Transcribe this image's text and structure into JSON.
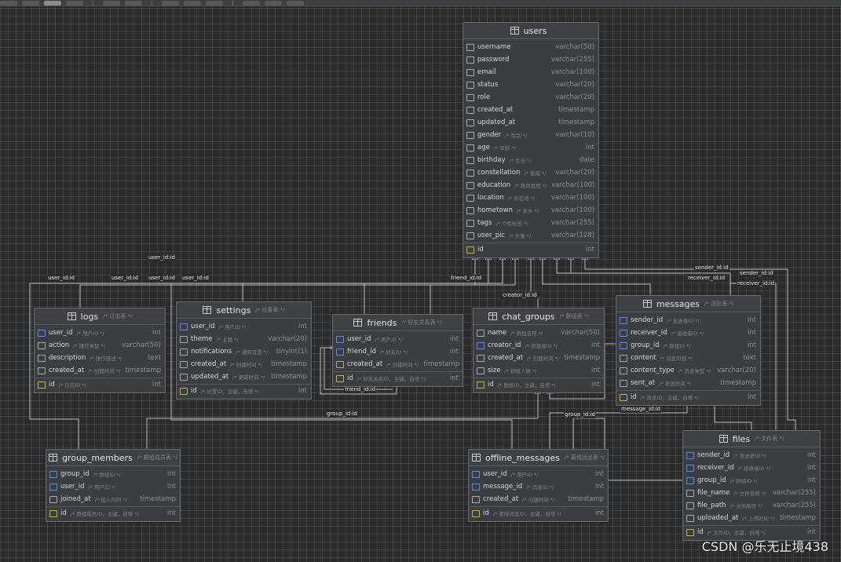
{
  "watermark": "CSDN @乐无止境438",
  "entities": {
    "users": {
      "name": "users",
      "comment": "",
      "columns": [
        {
          "name": "username",
          "comment": "",
          "type": "varchar(50)"
        },
        {
          "name": "password",
          "comment": "",
          "type": "varchar(255)"
        },
        {
          "name": "email",
          "comment": "",
          "type": "varchar(100)"
        },
        {
          "name": "status",
          "comment": "",
          "type": "varchar(20)"
        },
        {
          "name": "role",
          "comment": "",
          "type": "varchar(20)"
        },
        {
          "name": "created_at",
          "comment": "",
          "type": "timestamp"
        },
        {
          "name": "updated_at",
          "comment": "",
          "type": "timestamp"
        },
        {
          "name": "gender",
          "comment": "/* 性别 */",
          "type": "varchar(10)"
        },
        {
          "name": "age",
          "comment": "/* 年龄 */",
          "type": "int"
        },
        {
          "name": "birthday",
          "comment": "/* 生日 */",
          "type": "date"
        },
        {
          "name": "constellation",
          "comment": "/* 星座 */",
          "type": "varchar(20)"
        },
        {
          "name": "education",
          "comment": "/* 教育程度 */",
          "type": "varchar(100)"
        },
        {
          "name": "location",
          "comment": "/* 所在地 */",
          "type": "varchar(100)"
        },
        {
          "name": "hometown",
          "comment": "/* 家乡 */",
          "type": "varchar(100)"
        },
        {
          "name": "tags",
          "comment": "/* 个性标签 */",
          "type": "varchar(255)"
        },
        {
          "name": "user_pic",
          "comment": "/* 头像 */",
          "type": "varchar(128)"
        }
      ],
      "pk": {
        "name": "id",
        "comment": "",
        "type": "int"
      }
    },
    "logs": {
      "name": "logs",
      "comment": "/* 日志表 */",
      "columns": [
        {
          "name": "user_id",
          "comment": "/* 用户ID */",
          "type": "int"
        },
        {
          "name": "action",
          "comment": "/* 操作类型 */",
          "type": "varchar(50)"
        },
        {
          "name": "description",
          "comment": "/* 操作描述 */",
          "type": "text"
        },
        {
          "name": "created_at",
          "comment": "/* 创建时间 */",
          "type": "timestamp"
        }
      ],
      "pk": {
        "name": "id",
        "comment": "/* 日志ID */",
        "type": "int"
      }
    },
    "settings": {
      "name": "settings",
      "comment": "/* 设置表 */",
      "columns": [
        {
          "name": "user_id",
          "comment": "/* 用户ID */",
          "type": "int"
        },
        {
          "name": "theme",
          "comment": "/* 主题 */",
          "type": "varchar(20)"
        },
        {
          "name": "notifications",
          "comment": "/* 通知设置 */",
          "type": "tinyint(1)"
        },
        {
          "name": "created_at",
          "comment": "/* 创建时间 */",
          "type": "timestamp"
        },
        {
          "name": "updated_at",
          "comment": "/* 更新时间 */",
          "type": "timestamp"
        }
      ],
      "pk": {
        "name": "id",
        "comment": "/* 设置ID，主键，自增 */",
        "type": "int"
      }
    },
    "friends": {
      "name": "friends",
      "comment": "/* 好友关系表 */",
      "columns": [
        {
          "name": "user_id",
          "comment": "/* 用户ID */",
          "type": "int"
        },
        {
          "name": "friend_id",
          "comment": "/* 好友ID */",
          "type": "int"
        },
        {
          "name": "created_at",
          "comment": "/* 创建时间 */",
          "type": "timestamp"
        }
      ],
      "pk": {
        "name": "id",
        "comment": "/* 好友关系ID，主键，自增 */",
        "type": "int"
      }
    },
    "chat_groups": {
      "name": "chat_groups",
      "comment": "/* 群组表 */",
      "columns": [
        {
          "name": "name",
          "comment": "/* 群组名称 */",
          "type": "varchar(50)"
        },
        {
          "name": "creator_id",
          "comment": "/* 创建者ID */",
          "type": "int"
        },
        {
          "name": "created_at",
          "comment": "/* 创建时间 */",
          "type": "timestamp"
        },
        {
          "name": "size",
          "comment": "/* 群组人数 */",
          "type": "int"
        }
      ],
      "pk": {
        "name": "id",
        "comment": "/* 群组ID，主键，自增 */",
        "type": "int"
      }
    },
    "messages": {
      "name": "messages",
      "comment": "/* 消息表 */",
      "columns": [
        {
          "name": "sender_id",
          "comment": "/* 发送者ID */",
          "type": "int"
        },
        {
          "name": "receiver_id",
          "comment": "/* 接收者ID */",
          "type": "int"
        },
        {
          "name": "group_id",
          "comment": "/* 群组ID */",
          "type": "int"
        },
        {
          "name": "content",
          "comment": "/* 消息内容 */",
          "type": "text"
        },
        {
          "name": "content_type",
          "comment": "/* 消息类型 */",
          "type": "varchar(20)"
        },
        {
          "name": "sent_at",
          "comment": "/* 发送时间 */",
          "type": "timestamp"
        }
      ],
      "pk": {
        "name": "id",
        "comment": "/* 消息ID，主键，自增 */",
        "type": "int"
      }
    },
    "group_members": {
      "name": "group_members",
      "comment": "/* 群组成员表 */",
      "columns": [
        {
          "name": "group_id",
          "comment": "/* 群组ID */",
          "type": "int"
        },
        {
          "name": "user_id",
          "comment": "/* 用户ID */",
          "type": "int"
        },
        {
          "name": "joined_at",
          "comment": "/* 加入时间 */",
          "type": "timestamp"
        }
      ],
      "pk": {
        "name": "id",
        "comment": "/* 群组成员ID，主键，自增 */",
        "type": "int"
      }
    },
    "offline_messages": {
      "name": "offline_messages",
      "comment": "/* 离线消息表 */",
      "columns": [
        {
          "name": "user_id",
          "comment": "/* 用户ID */",
          "type": "int"
        },
        {
          "name": "message_id",
          "comment": "/* 消息ID */",
          "type": "int"
        },
        {
          "name": "created_at",
          "comment": "/* 创建时间 */",
          "type": "timestamp"
        }
      ],
      "pk": {
        "name": "id",
        "comment": "/* 离线消息ID，主键，自增 */",
        "type": "int"
      }
    },
    "files": {
      "name": "files",
      "comment": "/* 文件表 */",
      "columns": [
        {
          "name": "sender_id",
          "comment": "/* 发送者ID */",
          "type": "int"
        },
        {
          "name": "receiver_id",
          "comment": "/* 接收者ID */",
          "type": "int"
        },
        {
          "name": "group_id",
          "comment": "/* 群组ID */",
          "type": "int"
        },
        {
          "name": "file_name",
          "comment": "/* 文件名称 */",
          "type": "varchar(255)"
        },
        {
          "name": "file_path",
          "comment": "/* 文件路径 */",
          "type": "varchar(255)"
        },
        {
          "name": "uploaded_at",
          "comment": "/* 上传时间 */",
          "type": "timestamp"
        }
      ],
      "pk": {
        "name": "id",
        "comment": "/* 文件ID，主键，自增 */",
        "type": "int"
      }
    }
  },
  "relations": {
    "user_id_top": "user_id:id",
    "user_id_1": "user_id:id",
    "user_id_2": "user_id:id",
    "user_id_3": "user_id:id",
    "user_id_4": "user_id:id",
    "friend_id_top": "friend_id:id",
    "friend_id_bottom": "friend_id:id",
    "creator_id": "creator_id:id",
    "sender_id_1": "sender_id:id",
    "sender_id_2": "sender_id:id",
    "receiver_id_1": "receiver_id:id",
    "receiver_id_2": "receiver_id:id",
    "group_id_1": "group_id:id",
    "group_id_2": "group_id:id",
    "message_id": "message_id:id"
  }
}
